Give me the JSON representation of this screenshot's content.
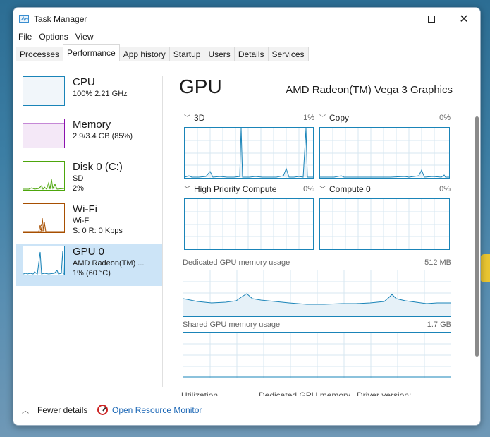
{
  "window": {
    "title": "Task Manager",
    "controls": {
      "minimize": "minimize",
      "maximize": "maximize",
      "close": "close"
    }
  },
  "menu": [
    "File",
    "Options",
    "View"
  ],
  "tabs": [
    "Processes",
    "Performance",
    "App history",
    "Startup",
    "Users",
    "Details",
    "Services"
  ],
  "active_tab": "Performance",
  "resources": [
    {
      "name": "CPU",
      "line1": "100%  2.21 GHz",
      "line2": "",
      "color": "#1a84b8"
    },
    {
      "name": "Memory",
      "line1": "2.9/3.4 GB (85%)",
      "line2": "",
      "color": "#8b12ae"
    },
    {
      "name": "Disk 0 (C:)",
      "line1": "SD",
      "line2": "2%",
      "color": "#4da60c"
    },
    {
      "name": "Wi-Fi",
      "line1": "Wi-Fi",
      "line2": "S: 0 R: 0 Kbps",
      "color": "#a74f01"
    },
    {
      "name": "GPU 0",
      "line1": "AMD Radeon(TM) ...",
      "line2": "1% (60 °C)",
      "color": "#1a84b8",
      "selected": true
    }
  ],
  "gpu": {
    "title": "GPU",
    "model": "AMD Radeon(TM) Vega 3 Graphics",
    "engines": [
      {
        "label": "3D",
        "percent": "1%"
      },
      {
        "label": "Copy",
        "percent": "0%"
      },
      {
        "label": "High Priority Compute",
        "percent": "0%"
      },
      {
        "label": "Compute 0",
        "percent": "0%"
      }
    ],
    "dedicated_label": "Dedicated GPU memory usage",
    "dedicated_value": "512 MB",
    "shared_label": "Shared GPU memory usage",
    "shared_value": "1.7 GB",
    "stats": {
      "utilization": "Utilization",
      "dedicated_memory": "Dedicated GPU memory",
      "driver_version": "Driver version:"
    }
  },
  "footer": {
    "fewer_details": "Fewer details",
    "open_resource_monitor": "Open Resource Monitor"
  },
  "colors": {
    "accent": "#1a84b8",
    "selected_bg": "#cce4f7",
    "link": "#1a66b5"
  }
}
